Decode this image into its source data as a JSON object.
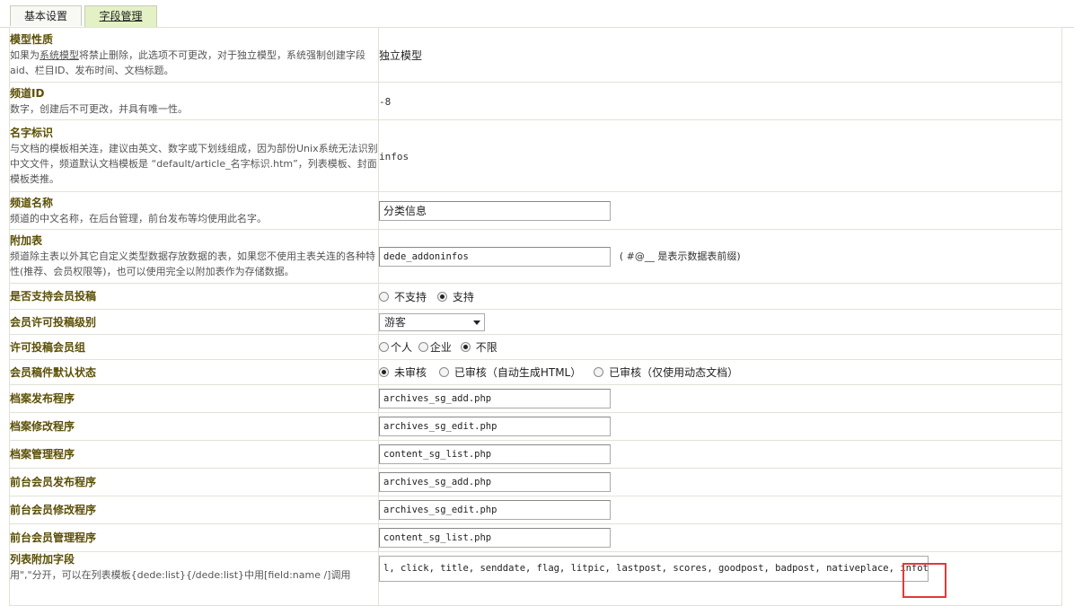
{
  "tabs": [
    {
      "label": "基本设置"
    },
    {
      "label": "字段管理"
    }
  ],
  "rows": {
    "model_nature": {
      "title": "模型性质",
      "desc_part1": "如果为",
      "desc_link": "系统模型",
      "desc_part2": "将禁止删除，此选项不可更改，对于独立模型，系统强制创建字段aid、栏目ID、发布时间、文档标题。",
      "value": "独立模型"
    },
    "channel_id": {
      "title": "频道ID",
      "desc": "数字，创建后不可更改，并具有唯一性。",
      "value": "-8"
    },
    "name_id": {
      "title": "名字标识",
      "desc": "与文档的模板相关连，建议由英文、数字或下划线组成，因为部份Unix系统无法识别中文文件，频道默认文档模板是 “default/article_名字标识.htm”，列表模板、封面模板类推。",
      "value": "infos"
    },
    "channel_name": {
      "title": "频道名称",
      "desc": "频道的中文名称，在后台管理，前台发布等均使用此名字。",
      "value": "分类信息"
    },
    "addon_table": {
      "title": "附加表",
      "desc": "频道除主表以外其它自定义类型数据存放数据的表，如果您不使用主表关连的各种特性(推荐、会员权限等)，也可以使用完全以附加表作为存储数据。",
      "value": "dede_addoninfos",
      "hint": "( #@__ 是表示数据表前缀)"
    },
    "member_post": {
      "title": "是否支持会员投稿",
      "options": [
        "不支持",
        "支持"
      ],
      "selected": 1
    },
    "member_level": {
      "title": "会员许可投稿级别",
      "value": "游客"
    },
    "member_group": {
      "title": "许可投稿会员组",
      "options": [
        "个人",
        "企业",
        "不限"
      ],
      "selected": 2
    },
    "default_state": {
      "title": "会员稿件默认状态",
      "options": [
        "未审核",
        "已审核（自动生成HTML）",
        "已审核（仅使用动态文档）"
      ],
      "selected": 0
    },
    "add_prog": {
      "title": "档案发布程序",
      "value": "archives_sg_add.php"
    },
    "edit_prog": {
      "title": "档案修改程序",
      "value": "archives_sg_edit.php"
    },
    "manage_prog": {
      "title": "档案管理程序",
      "value": "content_sg_list.php"
    },
    "front_add": {
      "title": "前台会员发布程序",
      "value": "archives_sg_add.php"
    },
    "front_edit": {
      "title": "前台会员修改程序",
      "value": "archives_sg_edit.php"
    },
    "front_manage": {
      "title": "前台会员管理程序",
      "value": "content_sg_list.php"
    },
    "list_fields": {
      "title": "列表附加字段",
      "desc": "用\",\"分开，可以在列表模板{dede:list}{/dede:list}中用[field:name /]调用",
      "value": "l, click, title, senddate, flag, litpic, lastpost, scores, goodpost, badpost, nativeplace, infotype, endtime, body"
    }
  },
  "colors": {
    "label_title": "#5b4f06",
    "active_tab": "#e3f1c5",
    "highlight": "#e03a3a"
  }
}
